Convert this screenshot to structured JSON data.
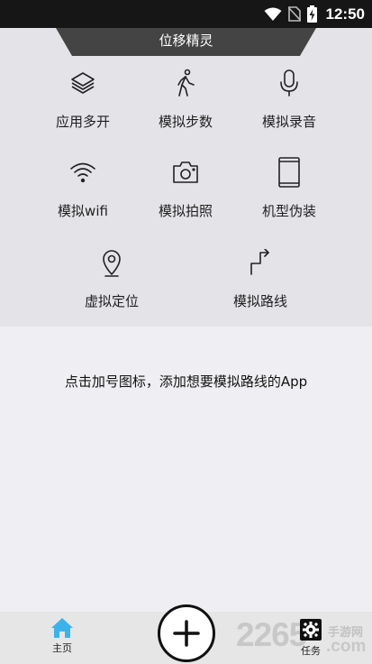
{
  "status_bar": {
    "time": "12:50",
    "icons": [
      "wifi-icon",
      "no-sim-icon",
      "battery-charging-icon"
    ]
  },
  "header": {
    "title": "位移精灵"
  },
  "features": [
    {
      "id": "multi-open",
      "label": "应用多开",
      "icon": "layers-icon"
    },
    {
      "id": "simulate-steps",
      "label": "模拟步数",
      "icon": "walking-person-icon"
    },
    {
      "id": "simulate-recording",
      "label": "模拟录音",
      "icon": "microphone-icon"
    },
    {
      "id": "simulate-wifi",
      "label": "模拟wifi",
      "icon": "wifi-icon"
    },
    {
      "id": "simulate-photo",
      "label": "模拟拍照",
      "icon": "camera-icon"
    },
    {
      "id": "device-disguise",
      "label": "机型伪装",
      "icon": "phone-icon"
    },
    {
      "id": "virtual-location",
      "label": "虚拟定位",
      "icon": "location-pin-icon"
    },
    {
      "id": "simulate-route",
      "label": "模拟路线",
      "icon": "route-arrow-icon"
    }
  ],
  "hint": "点击加号图标，添加想要模拟路线的App",
  "bottom_nav": {
    "home_label": "主页",
    "task_label": "任务",
    "home_icon": "home-icon",
    "task_icon": "gear-icon",
    "add_icon": "plus-icon",
    "accent": "#3bb3ea"
  },
  "watermark": {
    "number": "2265",
    "site": "手游网",
    "domain": ".com"
  }
}
